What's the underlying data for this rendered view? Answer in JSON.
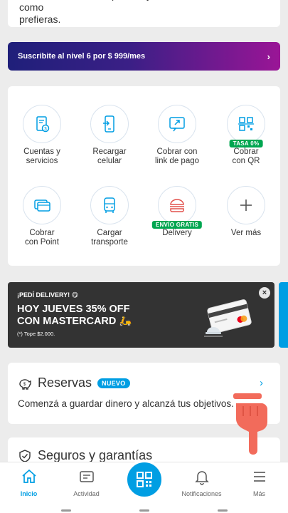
{
  "top_card": {
    "line1": "Consultá tu límite disponible y usá tu línea de crédito como",
    "line2": "prefieras."
  },
  "banner": {
    "label": "Suscribite al nivel 6 por $ 999/mes",
    "chevron": "›"
  },
  "actions": [
    {
      "label1": "Cuentas y",
      "label2": "servicios",
      "icon": "bill-icon"
    },
    {
      "label1": "Recargar",
      "label2": "celular",
      "icon": "phone-recharge-icon"
    },
    {
      "label1": "Cobrar con",
      "label2": "link de pago",
      "icon": "link-icon"
    },
    {
      "label1": "Cobrar",
      "label2": "con QR",
      "icon": "qr-icon",
      "tag": "TASA 0%"
    },
    {
      "label1": "Cobrar",
      "label2": "con Point",
      "icon": "point-device-icon"
    },
    {
      "label1": "Cargar",
      "label2": "transporte",
      "icon": "bus-icon"
    },
    {
      "label1": "Delivery",
      "label2": "",
      "icon": "burger-icon",
      "tag": "ENVÍO GRATIS"
    },
    {
      "label1": "Ver más",
      "label2": "",
      "icon": "plus-icon"
    }
  ],
  "promo": {
    "kicker": "¡PEDÍ DELIVERY! 😋",
    "headline1": "HOY JUEVES 35% OFF",
    "headline2": "CON MASTERCARD 🛵",
    "footnote": "(*) Tope $2.000.",
    "close": "×"
  },
  "reservas": {
    "title": "Reservas",
    "badge": "NUEVO",
    "subtitle": "Comenzá a guardar dinero y alcanzá tus objetivos.",
    "chevron": "›"
  },
  "seguros": {
    "title": "Seguros y garantías"
  },
  "tabbar": {
    "inicio": "Inicio",
    "actividad": "Actividad",
    "notificaciones": "Notificaciones",
    "mas": "Más"
  },
  "colors": {
    "accent": "#009ee3",
    "green_tag": "#00a650",
    "hand": "#f26b5b"
  }
}
